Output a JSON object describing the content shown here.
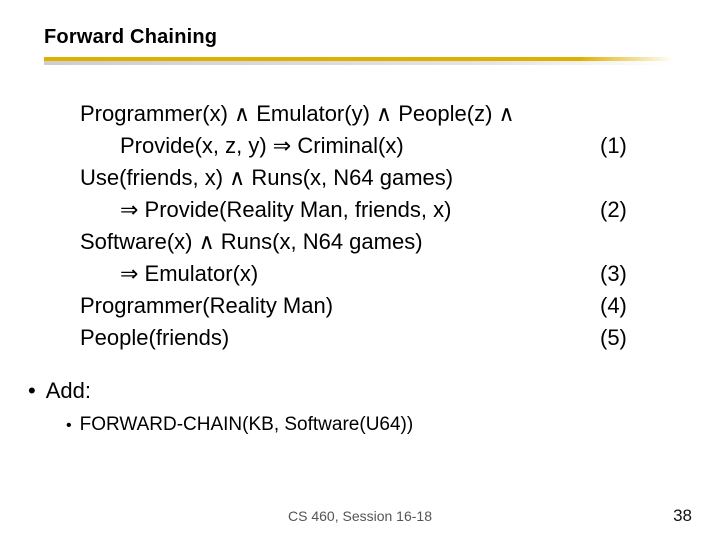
{
  "title": "Forward Chaining",
  "rules": {
    "r1a": "Programmer(x) ∧ Emulator(y) ∧ People(z) ∧",
    "r1b": "Provide(x, z, y) ⇒ Criminal(x)",
    "n1": "(1)",
    "r2a": "Use(friends, x) ∧ Runs(x, N64 games)",
    "r2b": "⇒ Provide(Reality Man, friends, x)",
    "n2": "(2)",
    "r3a": "Software(x) ∧ Runs(x, N64 games)",
    "r3b": "⇒ Emulator(x)",
    "n3": "(3)",
    "r4": "Programmer(Reality Man)",
    "n4": "(4)",
    "r5": "People(friends)",
    "n5": "(5)"
  },
  "add": {
    "label": "Add:",
    "sub": "FORWARD-CHAIN(KB, Software(U64))"
  },
  "footer": "CS 460,  Session 16-18",
  "page": "38"
}
